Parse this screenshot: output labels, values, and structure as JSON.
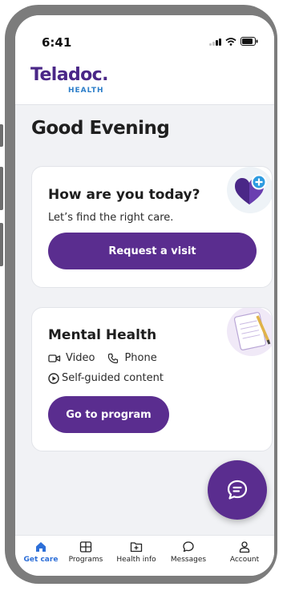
{
  "status_bar": {
    "time": "6:41"
  },
  "header": {
    "logo_main": "Teladoc.",
    "logo_sub": "HEALTH"
  },
  "greeting": "Good Evening",
  "care_card": {
    "title": "How are you today?",
    "subtitle": "Let’s find the right care.",
    "button_label": "Request a visit"
  },
  "mental_card": {
    "title": "Mental Health",
    "video_label": "Video",
    "phone_label": "Phone",
    "content_label": "Self-guided content",
    "button_label": "Go to program"
  },
  "tabs": [
    {
      "label": "Get care",
      "icon": "home-icon",
      "active": true
    },
    {
      "label": "Programs",
      "icon": "grid-icon",
      "active": false
    },
    {
      "label": "Health info",
      "icon": "folder-plus-icon",
      "active": false
    },
    {
      "label": "Messages",
      "icon": "chat-bubble-icon",
      "active": false
    },
    {
      "label": "Account",
      "icon": "person-icon",
      "active": false
    }
  ],
  "colors": {
    "brand_purple": "#5a2d8f",
    "logo_blue": "#2c7ec9",
    "active_tab": "#2d6fd8",
    "background": "#f1f2f5"
  }
}
